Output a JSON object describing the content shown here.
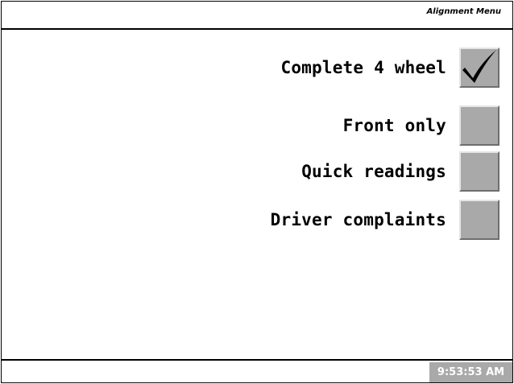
{
  "header": {
    "title": "Alignment Menu"
  },
  "menu": {
    "options": [
      {
        "label": "Complete 4 wheel",
        "checked": true
      },
      {
        "label": "Front only",
        "checked": false
      },
      {
        "label": "Quick readings",
        "checked": false
      },
      {
        "label": "Driver complaints",
        "checked": false
      }
    ]
  },
  "footer": {
    "time": "9:53:53 AM"
  },
  "colors": {
    "background": "#ffffff",
    "checkbox_fill": "#a9a9a9",
    "clock_background": "#a9a9a9",
    "clock_text": "#ffffff",
    "text": "#000000"
  },
  "icons": {
    "checkmark": "checkmark-icon"
  }
}
